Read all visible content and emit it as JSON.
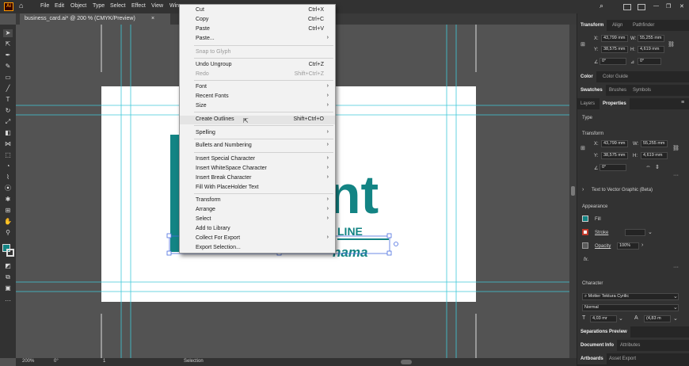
{
  "app": {
    "icon_text": "Ai"
  },
  "menubar": [
    "File",
    "Edit",
    "Object",
    "Type",
    "Select",
    "Effect",
    "View",
    "Win"
  ],
  "document_tab": {
    "title": "business_card.ai* @ 200 % (CMYK/Preview)",
    "close": "×"
  },
  "context_menu": {
    "items": [
      {
        "label": "Cut",
        "shortcut": "Ctrl+X"
      },
      {
        "label": "Copy",
        "shortcut": "Ctrl+C"
      },
      {
        "label": "Paste",
        "shortcut": "Ctrl+V"
      },
      {
        "label": "Paste...",
        "submenu": true
      },
      {
        "label": "Snap to Glyph",
        "disabled": true
      },
      {
        "label": "Undo Ungroup",
        "shortcut": "Ctrl+Z"
      },
      {
        "label": "Redo",
        "shortcut": "Shift+Ctrl+Z",
        "disabled": true
      },
      {
        "label": "Font",
        "submenu": true
      },
      {
        "label": "Recent Fonts",
        "submenu": true
      },
      {
        "label": "Size",
        "submenu": true
      },
      {
        "label": "Create Outlines",
        "shortcut": "Shift+Ctrl+O",
        "highlighted": true
      },
      {
        "label": "Spelling",
        "submenu": true
      },
      {
        "label": "Bullets and Numbering",
        "submenu": true
      },
      {
        "label": "Insert Special Character",
        "submenu": true
      },
      {
        "label": "Insert WhiteSpace Character",
        "submenu": true
      },
      {
        "label": "Insert Break Character",
        "submenu": true
      },
      {
        "label": "Fill With PlaceHolder Text"
      },
      {
        "label": "Transform",
        "submenu": true
      },
      {
        "label": "Arrange",
        "submenu": true
      },
      {
        "label": "Select",
        "submenu": true
      },
      {
        "label": "Add to Library"
      },
      {
        "label": "Collect For Export",
        "submenu": true
      },
      {
        "label": "Export Selection..."
      }
    ]
  },
  "artwork": {
    "text_large": "nt",
    "text_line": "LINE",
    "text_bottom": "nama",
    "color": "#138484"
  },
  "statusbar": {
    "zoom": "200%",
    "rotation": "0°",
    "artboard": "1",
    "tool": "Selection"
  },
  "panel": {
    "top_tabs": [
      "Transform",
      "Align",
      "Pathfinder"
    ],
    "transform": {
      "x": "43,799 mm",
      "y": "38,575 mm",
      "w": "55,255 mm",
      "h": "4,619 mm",
      "angle": "0°",
      "shear": "0°"
    },
    "color_tabs": [
      "Color",
      "Color Guide"
    ],
    "swatch_tabs": [
      "Swatches",
      "Brushes",
      "Symbols"
    ],
    "prop_tabs": [
      "Layers",
      "Properties"
    ],
    "properties": {
      "type_label": "Type",
      "transform_label": "Transform",
      "x": "43,799 mm",
      "y": "38,575 mm",
      "w": "55,255 mm",
      "h": "4,619 mm",
      "angle": "0°",
      "text_to_vector": "Text to Vector Graphic (Beta)",
      "appearance_label": "Appearance",
      "fill_label": "Fill",
      "stroke_label": "Stroke",
      "opacity_label": "Opacity",
      "opacity_value": "100%",
      "fx": "fx.",
      "character_label": "Character",
      "font": "Motter Tektura Cyrilic",
      "style": "Normal",
      "size": "4,03 mr",
      "leading": "(4,83 m"
    },
    "sep_tab": "Separations Preview",
    "doc_tabs": [
      "Document Info",
      "Attributes"
    ],
    "art_tabs": [
      "Artboards",
      "Asset Export"
    ]
  },
  "colors": {
    "accent": "#138484",
    "guide": "#3fc8d8",
    "selection": "#4a6ee0"
  }
}
